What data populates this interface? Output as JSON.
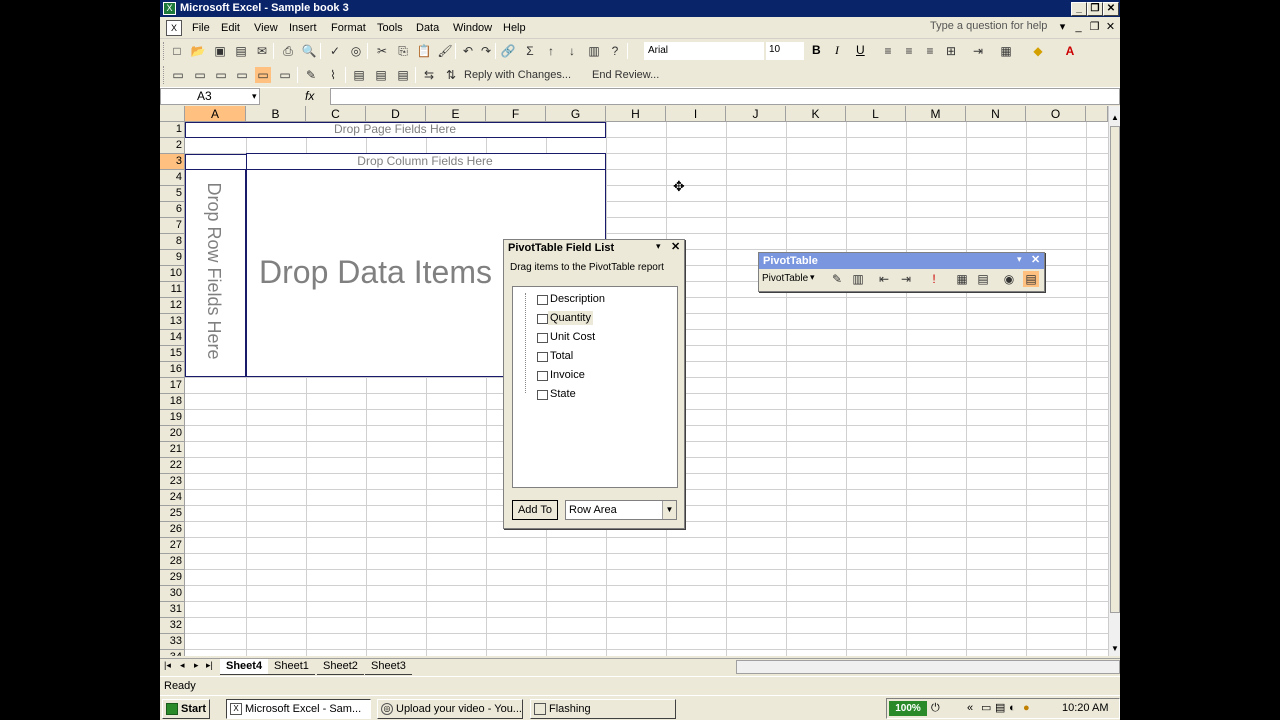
{
  "window": {
    "title": "Microsoft Excel - Sample book 3",
    "ask_placeholder": "Type a question for help"
  },
  "menu": [
    "File",
    "Edit",
    "View",
    "Insert",
    "Format",
    "Tools",
    "Data",
    "Window",
    "Help"
  ],
  "toolbar": {
    "font": "Arial",
    "size": "10",
    "bold": "B",
    "italic": "I",
    "underline": "U",
    "reply": "Reply with Changes...",
    "end_review": "End Review..."
  },
  "formula": {
    "namebox": "A3",
    "fx": "fx",
    "value": ""
  },
  "columns": [
    "A",
    "B",
    "C",
    "D",
    "E",
    "F",
    "G",
    "H",
    "I",
    "J",
    "K",
    "L",
    "M",
    "N",
    "O"
  ],
  "rows": [
    "1",
    "2",
    "3",
    "4",
    "5",
    "6",
    "7",
    "8",
    "9",
    "10",
    "11",
    "12",
    "13",
    "14",
    "15",
    "16",
    "17",
    "18",
    "19",
    "20",
    "21",
    "22",
    "23",
    "24",
    "25",
    "26",
    "27",
    "28",
    "29",
    "30",
    "31",
    "32",
    "33",
    "34"
  ],
  "pivot_zones": {
    "page": "Drop Page Fields Here",
    "column": "Drop Column Fields Here",
    "row": "Drop Row Fields Here",
    "data": "Drop Data Items"
  },
  "field_list": {
    "title": "PivotTable Field List",
    "instruction": "Drag items to the PivotTable report",
    "items": [
      "Description",
      "Quantity",
      "Unit Cost",
      "Total",
      "Invoice",
      "State"
    ],
    "selected_item": "Quantity",
    "add_to_label": "Add To",
    "area": "Row Area"
  },
  "pivot_toolbar": {
    "title": "PivotTable",
    "menu_label": "PivotTable"
  },
  "sheets": [
    "Sheet4",
    "Sheet1",
    "Sheet2",
    "Sheet3"
  ],
  "active_sheet": "Sheet4",
  "status": "Ready",
  "taskbar": {
    "start": "Start",
    "tasks": [
      "Microsoft Excel - Sam...",
      "Upload your video - You...",
      "Flashing"
    ],
    "zoom": "100%",
    "clock": "10:20 AM"
  }
}
